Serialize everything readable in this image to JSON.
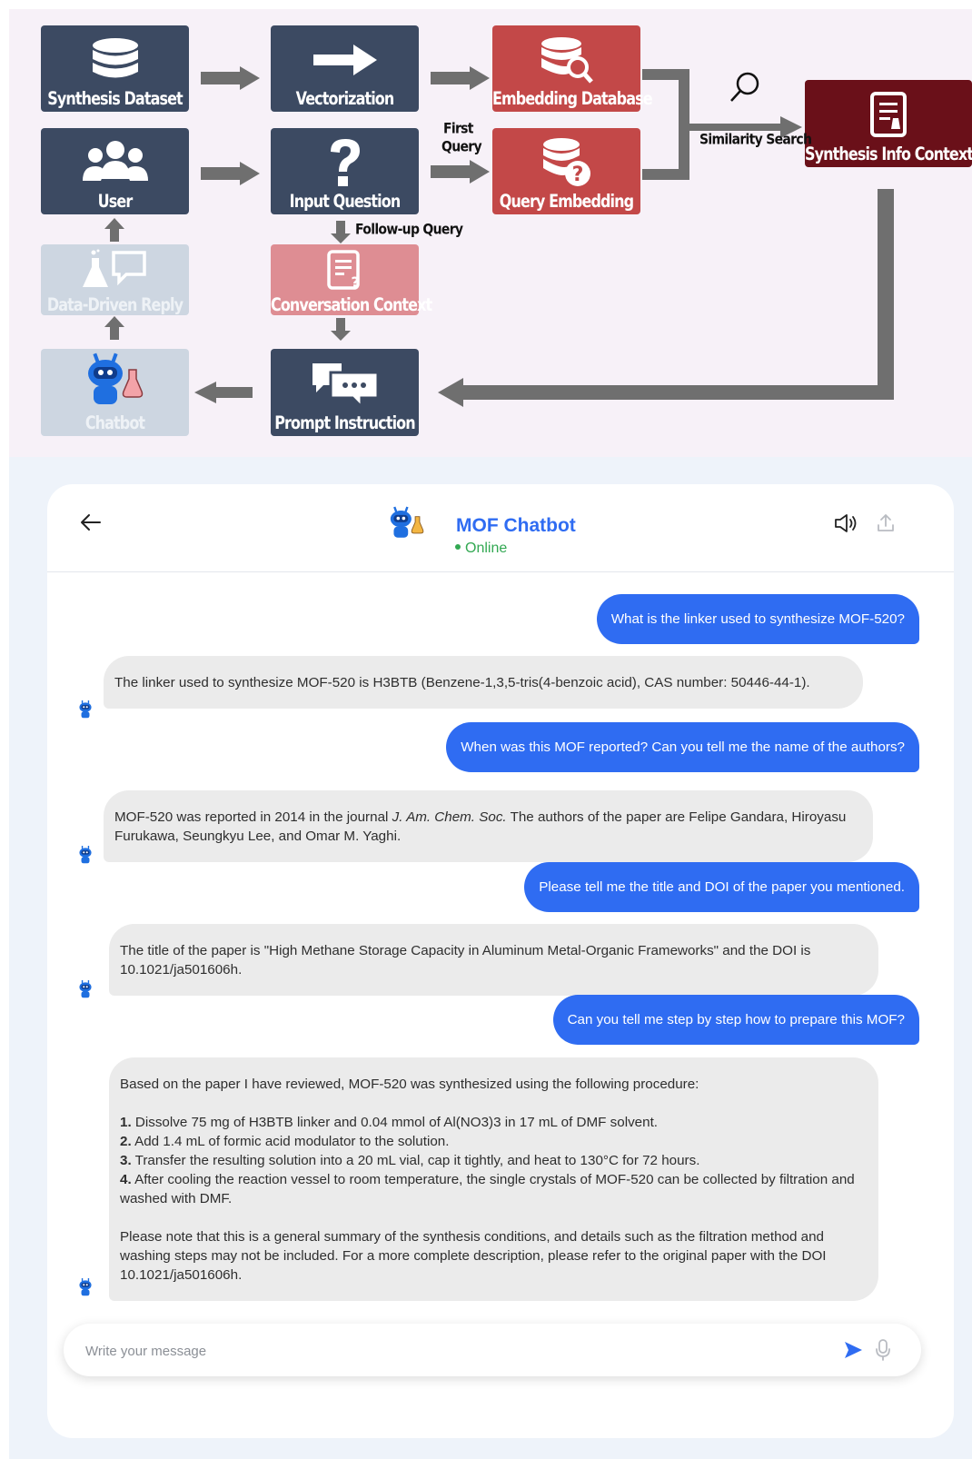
{
  "diagram": {
    "nodes": {
      "synthesis_dataset": "Synthesis Dataset",
      "vectorization": "Vectorization",
      "embedding_database": "Embedding Database",
      "user": "User",
      "input_question": "Input Question",
      "query_embedding": "Query Embedding",
      "synthesis_info_context": "Synthesis Info Context",
      "data_driven_reply": "Data-Driven Reply",
      "conversation_context": "Conversation Context",
      "chatbot": "Chatbot",
      "prompt_instruction": "Prompt Instruction"
    },
    "edge_labels": {
      "first_query_line1": "First",
      "first_query_line2": "Query",
      "follow_up_query": "Follow-up Query",
      "similarity_search": "Similarity Search"
    },
    "colors": {
      "navy": "#3c4a62",
      "red": "#c34848",
      "maroon": "#6a1019",
      "pale": "#cdd6e1",
      "pink": "#de8d93",
      "arrow": "#6f6f6f"
    }
  },
  "chat": {
    "title": "MOF Chatbot",
    "status": "Online",
    "accent_color": "#2f6cf2",
    "status_color": "#32a852",
    "header_icons": [
      "back-arrow-icon",
      "speaker-icon",
      "share-icon"
    ],
    "messages": [
      {
        "role": "user",
        "text": "What is the linker used to synthesize MOF-520?"
      },
      {
        "role": "bot",
        "lines": [
          "The linker used to synthesize MOF-520 is H3BTB (Benzene-1,3,5-tris(4-benzoic acid), CAS number: 50446-44-1)."
        ]
      },
      {
        "role": "user",
        "text": "When was this MOF reported? Can you tell me the name of the authors?"
      },
      {
        "role": "bot",
        "text_a": "MOF-520 was reported in 2014 in the journal ",
        "journal": "J. Am. Chem. Soc.",
        "text_b": " The authors of the paper are Felipe Gandara, Hiroyasu Furukawa, Seungkyu Lee, and Omar M. Yaghi."
      },
      {
        "role": "user",
        "text": "Please tell me the title and DOI of the paper you mentioned."
      },
      {
        "role": "bot",
        "lines": [
          "The title of the paper is \"High Methane Storage Capacity in Aluminum Metal-Organic Frameworks\" and the DOI is 10.1021/ja501606h."
        ]
      },
      {
        "role": "user",
        "text": "Can you tell me step by step how to prepare this MOF?"
      },
      {
        "role": "bot",
        "intro": "Based on the paper I have reviewed, MOF-520 was synthesized using the following procedure:",
        "steps": [
          {
            "num": "1.",
            "text": "Dissolve 75 mg of H3BTB linker and 0.04 mmol of Al(NO3)3 in 17 mL of DMF solvent."
          },
          {
            "num": "2.",
            "text": "Add 1.4 mL of formic acid modulator to the solution."
          },
          {
            "num": "3.",
            "text": "Transfer the resulting solution into a 20 mL vial, cap it tightly, and heat to 130°C for 72 hours."
          },
          {
            "num": "4.",
            "text": "After cooling the reaction vessel to room temperature, the single crystals of MOF-520 can be collected by filtration and washed with DMF."
          }
        ],
        "note": "Please note that this is a general summary of the synthesis conditions, and details such as the filtration method and washing steps may not be included. For a more complete description, please refer to the original paper with the DOI 10.1021/ja501606h."
      }
    ],
    "composer": {
      "placeholder": "Write your message",
      "icons": [
        "send-icon",
        "microphone-icon"
      ]
    }
  }
}
